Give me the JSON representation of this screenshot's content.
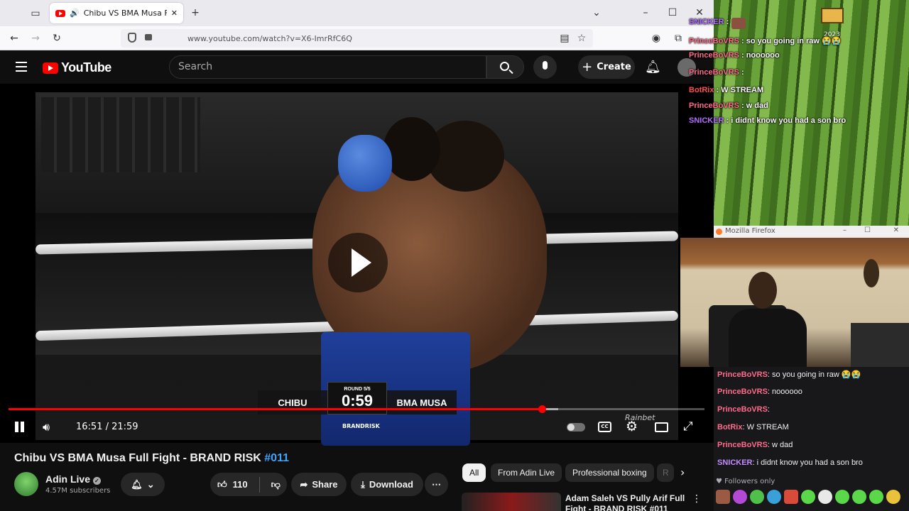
{
  "browser": {
    "tab_title": "Chibu VS BMA Musa Full Fi",
    "url": "www.youtube.com/watch?v=X6-ImrRfC6Q"
  },
  "youtube": {
    "logo_text": "YouTube",
    "search_placeholder": "Search",
    "create_label": "Create"
  },
  "player": {
    "time": "16:51 / 21:59",
    "progress": 0.766,
    "buffered": 0.79,
    "scoreboard": {
      "left": "CHIBU",
      "round": "ROUND 5/5",
      "clock": "0:59",
      "right": "BMA MUSA",
      "brand": "BRANDRISK"
    },
    "watermark": "Rainbet"
  },
  "video": {
    "title": "Chibu VS BMA Musa Full Fight - BRAND RISK",
    "title_tag": "#011",
    "channel": "Adin Live",
    "subscribers": "4.57M subscribers",
    "likes": "110",
    "share_label": "Share",
    "download_label": "Download"
  },
  "chips": [
    "All",
    "From Adin Live",
    "Professional boxing",
    "R"
  ],
  "recommended": {
    "title_line1": "Adam Saleh VS Pully Arif Full",
    "title_line2": "Fight - BRAND RISK #011"
  },
  "overlay_chat": [
    {
      "user": "SNICKER",
      "color": "#b46bff",
      "msg": ""
    },
    {
      "user": "PrinceBoVRS",
      "color": "#ff6b8a",
      "msg": "so you going in raw 😭😭"
    },
    {
      "user": "PrinceBoVRS",
      "color": "#ff6b8a",
      "msg": "noooooo"
    },
    {
      "user": "PrinceBoVRS",
      "color": "#ff6b8a",
      "msg": ""
    },
    {
      "user": "BotRix",
      "color": "#ff4e4e",
      "msg": "W STREAM"
    },
    {
      "user": "PrinceBoVRS",
      "color": "#ff6b8a",
      "msg": "w dad"
    },
    {
      "user": "SNICKER",
      "color": "#b46bff",
      "msg": "i didnt know you had a son bro"
    }
  ],
  "overlay_year": "2023",
  "firefox_title": "Mozilla Firefox",
  "chat": [
    {
      "user": "PrinceBoVRS",
      "color": "#ff6b8a",
      "msg": "so you going in raw 😭😭"
    },
    {
      "user": "PrinceBoVRS",
      "color": "#ff6b8a",
      "msg": "noooooo"
    },
    {
      "user": "PrinceBoVRS",
      "color": "#ff6b8a",
      "msg": ""
    },
    {
      "user": "BotRix",
      "color": "#ff6b8a",
      "msg": "W STREAM"
    },
    {
      "user": "PrinceBoVRS",
      "color": "#ff6b8a",
      "msg": "w dad"
    },
    {
      "user": "SNICKER",
      "color": "#c48bff",
      "msg": "i didnt know you had a son bro"
    }
  ],
  "chat_mode": "Followers only"
}
